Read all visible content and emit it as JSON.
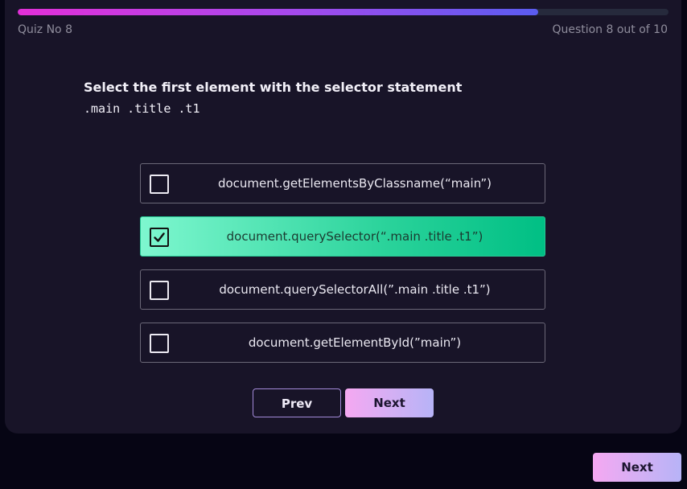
{
  "progress": {
    "fraction": 0.8
  },
  "header": {
    "quiz_label": "Quiz No 8",
    "question_count": "Question 8 out of 10"
  },
  "question": {
    "text": "Select the first element with the selector statement",
    "code": ".main .title .t1"
  },
  "options": [
    {
      "label": "document.getElementsByClassname(“main”)",
      "checked": false
    },
    {
      "label": "document.querySelector(“.main .title .t1”)",
      "checked": true
    },
    {
      "label": "document.querySelectorAll(”.main .title .t1”)",
      "checked": false
    },
    {
      "label": "document.getElementById(”main”)",
      "checked": false
    }
  ],
  "buttons": {
    "prev": "Prev",
    "next": "Next",
    "footer_next": "Next"
  },
  "colors": {
    "accent_gradient_start": "#e32fd8",
    "accent_gradient_end": "#5a5cf0",
    "selected_option": "#2bd39b",
    "card_background": "#181428",
    "page_background": "#060514"
  }
}
